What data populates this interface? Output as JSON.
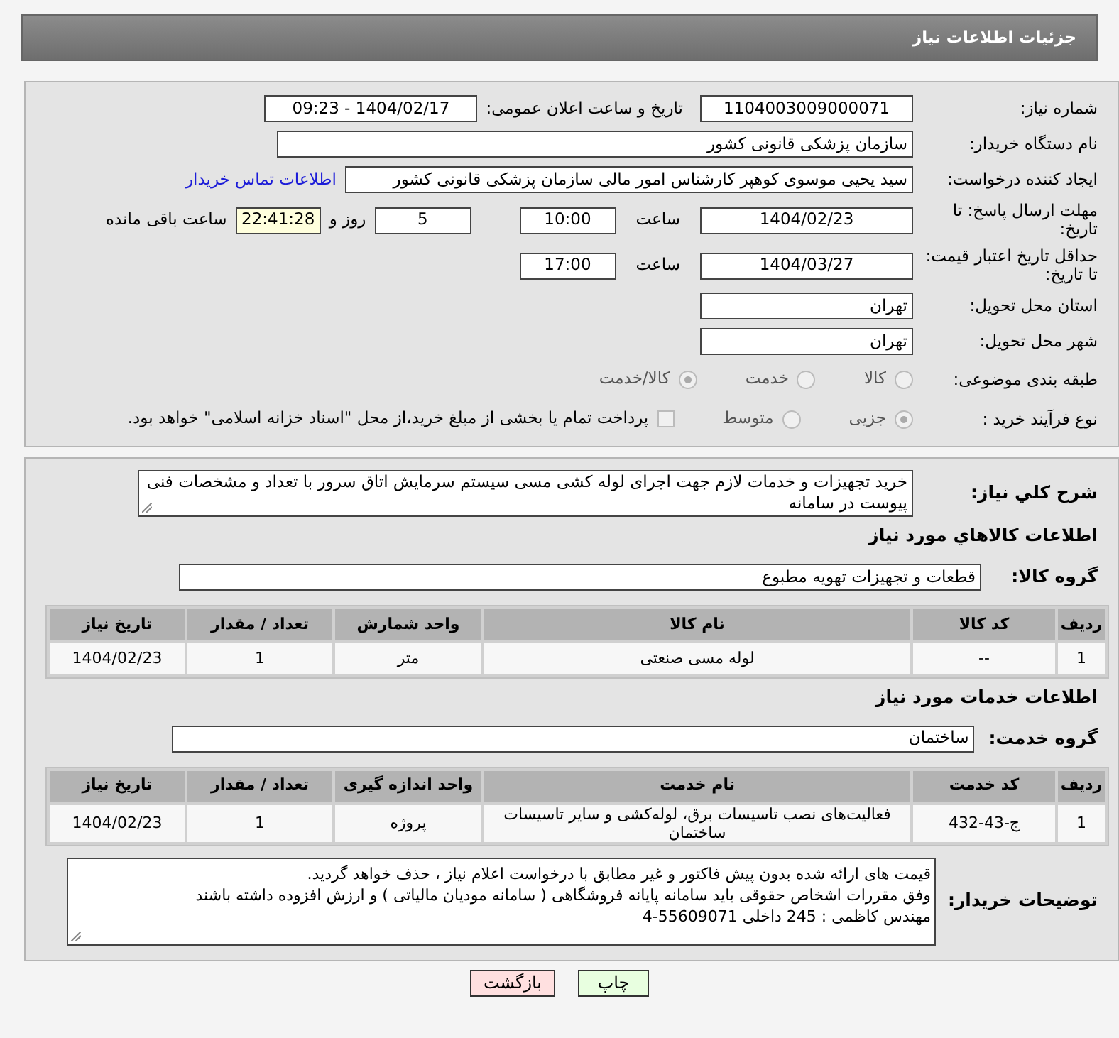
{
  "header": {
    "title": "جزئیات اطلاعات نیاز"
  },
  "details": {
    "need_number": {
      "label": "شماره نیاز:",
      "value": "1104003009000071"
    },
    "announce": {
      "label": "تاریخ و ساعت اعلان عمومی:",
      "value": "1404/02/17 - 09:23"
    },
    "buyer_org": {
      "label": "نام دستگاه خریدار:",
      "value": "سازمان پزشکی قانونی کشور"
    },
    "requester": {
      "label": "ایجاد کننده درخواست:",
      "value": "سید یحیی موسوی کوهپر کارشناس امور مالی سازمان پزشکی قانونی کشور",
      "link": "اطلاعات تماس خریدار"
    },
    "reply_deadline": {
      "label": "مهلت ارسال پاسخ: تا تاریخ:",
      "date": "1404/02/23",
      "time_label": "ساعت",
      "time": "10:00",
      "days": "5",
      "days_label": "روز و",
      "remaining": "22:41:28",
      "remaining_label": "ساعت باقی مانده"
    },
    "price_validity": {
      "label": "حداقل تاریخ اعتبار قیمت: تا تاریخ:",
      "date": "1404/03/27",
      "time_label": "ساعت",
      "time": "17:00"
    },
    "province": {
      "label": "استان محل تحویل:",
      "value": "تهران"
    },
    "city": {
      "label": "شهر محل تحویل:",
      "value": "تهران"
    },
    "category": {
      "label": "طبقه بندی موضوعی:",
      "options": [
        {
          "label": "کالا",
          "selected": false
        },
        {
          "label": "خدمت",
          "selected": false
        },
        {
          "label": "کالا/خدمت",
          "selected": true
        }
      ]
    },
    "process": {
      "label": "نوع فرآیند خرید :",
      "options": [
        {
          "label": "جزیی",
          "selected": true
        },
        {
          "label": "متوسط",
          "selected": false
        }
      ],
      "treasury": {
        "label": "پرداخت تمام یا بخشی از مبلغ خرید،از محل \"اسناد خزانه اسلامی\" خواهد بود.",
        "checked": false
      }
    }
  },
  "need": {
    "summary": {
      "label": "شرح کلي نياز:",
      "value": "خرید تجهیزات و خدمات لازم جهت اجرای لوله کشی مسی سیستم سرمایش اتاق سرور  با تعداد و مشخصات فنی پیوست در سامانه"
    },
    "goods": {
      "heading": "اطلاعات کالاهاي مورد نياز",
      "group_label": "گروه کالا:",
      "group": "قطعات و تجهیزات تهویه مطبوع",
      "columns": [
        "ردیف",
        "کد کالا",
        "نام کالا",
        "واحد شمارش",
        "تعداد / مقدار",
        "تاریخ نیاز"
      ],
      "rows": [
        [
          "1",
          "--",
          "لوله مسی صنعتی",
          "متر",
          "1",
          "1404/02/23"
        ]
      ]
    },
    "services": {
      "heading": "اطلاعات خدمات مورد نياز",
      "group_label": "گروه خدمت:",
      "group": "ساختمان",
      "columns": [
        "ردیف",
        "کد خدمت",
        "نام خدمت",
        "واحد اندازه گیری",
        "تعداد / مقدار",
        "تاریخ نیاز"
      ],
      "rows": [
        [
          "1",
          "ج-43-432",
          "فعالیت‌های نصب تاسیسات برق، لوله‌کشی و سایر تاسیسات ساختمان",
          "پروژه",
          "1",
          "1404/02/23"
        ]
      ]
    },
    "notes": {
      "label": "توضیحات خریدار:",
      "value": "قیمت های ارائه شده بدون پیش فاکتور  و غیر مطابق با درخواست اعلام نیاز  ، حذف خواهد گردید.\nوفق مقررات اشخاص حقوقی باید سامانه پایانه فروشگاهی ( سامانه مودیان مالیاتی ) و ارزش افزوده  داشته باشند\nمهندس کاظمی  :   245   داخلی       55609071-4"
    }
  },
  "buttons": [
    {
      "label": "چاپ",
      "kind": "print"
    },
    {
      "label": "بازگشت",
      "kind": "back"
    }
  ]
}
